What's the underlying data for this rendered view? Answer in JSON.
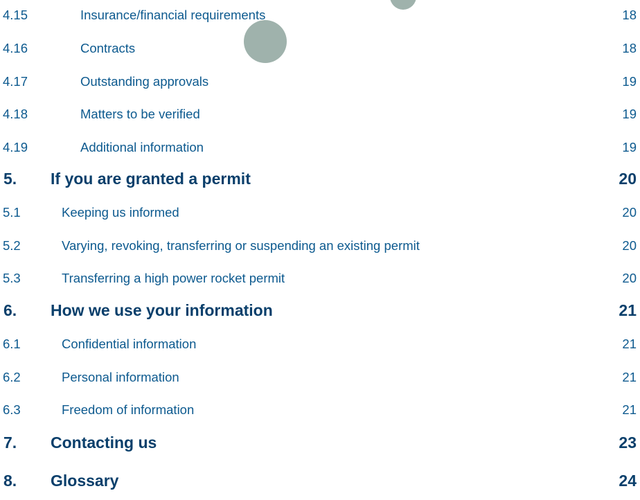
{
  "toc": {
    "entries": [
      {
        "num": "4.15",
        "title": "Insurance/financial requirements",
        "page": "18"
      },
      {
        "num": "4.16",
        "title": "Contracts",
        "page": "18"
      },
      {
        "num": "4.17",
        "title": "Outstanding approvals",
        "page": "19"
      },
      {
        "num": "4.18",
        "title": "Matters to be verified",
        "page": "19"
      },
      {
        "num": "4.19",
        "title": "Additional information",
        "page": "19"
      },
      {
        "num": "5.",
        "title": "If you are granted a permit",
        "page": "20"
      },
      {
        "num": "5.1",
        "title": "Keeping us informed",
        "page": "20"
      },
      {
        "num": "5.2",
        "title": "Varying, revoking, transferring or suspending an existing permit",
        "page": "20"
      },
      {
        "num": "5.3",
        "title": "Transferring a high power rocket permit",
        "page": "20"
      },
      {
        "num": "6.",
        "title": "How we use your information",
        "page": "21"
      },
      {
        "num": "6.1",
        "title": "Confidential information",
        "page": "21"
      },
      {
        "num": "6.2",
        "title": "Personal information",
        "page": "21"
      },
      {
        "num": "6.3",
        "title": "Freedom of information",
        "page": "21"
      },
      {
        "num": "7.",
        "title": "Contacting us",
        "page": "23"
      },
      {
        "num": "8.",
        "title": "Glossary",
        "page": "24"
      }
    ]
  },
  "colors": {
    "text_primary": "#0a3f6b",
    "text_secondary": "#0d5a8f",
    "decor": "#8ea49e"
  }
}
